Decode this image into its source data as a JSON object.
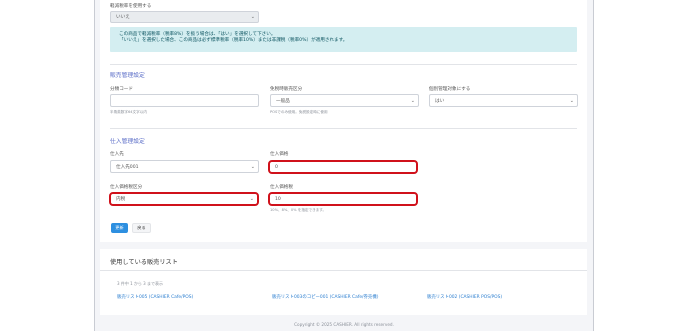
{
  "tax": {
    "label": "軽減税率を使用する",
    "value": "いいえ",
    "info_line1": "この商品で軽減税率（税率8%）を扱う場合は、「はい」を選択して下さい。",
    "info_line2": "「いいえ」を選択した場合、この商品は必ず標準税率（税率10%）または非課税（税率0%）が適用されます。"
  },
  "sales": {
    "title": "販売管理設定",
    "bunrui_label": "分類コード",
    "bunrui_value": "",
    "bunrui_hint": "半角英数字64文字以内",
    "pos_label": "免税時販売区分",
    "pos_value": "一般品",
    "pos_hint": "POSでのみ使用。免税設定時に使用",
    "indiv_label": "個別管理対象にする",
    "indiv_value": "はい"
  },
  "purchase": {
    "title": "仕入管理設定",
    "supplier_label": "仕入先",
    "supplier_value": "仕入先001",
    "price_label": "仕入価格",
    "price_value": "0",
    "tax_type_label": "仕入価格税区分",
    "tax_type_value": "内税",
    "tax_rate_label": "仕入価格税",
    "tax_rate_value": "10",
    "tax_rate_hint": "10%、8%、0% を指定できます。"
  },
  "buttons": {
    "update": "更新",
    "back": "戻る"
  },
  "list": {
    "title": "使用している販売リスト",
    "count": "3 件中 1 から 3 まで表示",
    "items": [
      "販売リスト005 (CASHIER Cafe/POS)",
      "販売リスト003のコピー001 (CASHIER Cafe/券売機)",
      "販売リスト002 (CASHIER POS/POS)"
    ]
  },
  "footer": "Copyright © 2025 CASHIER. All rights reserved."
}
